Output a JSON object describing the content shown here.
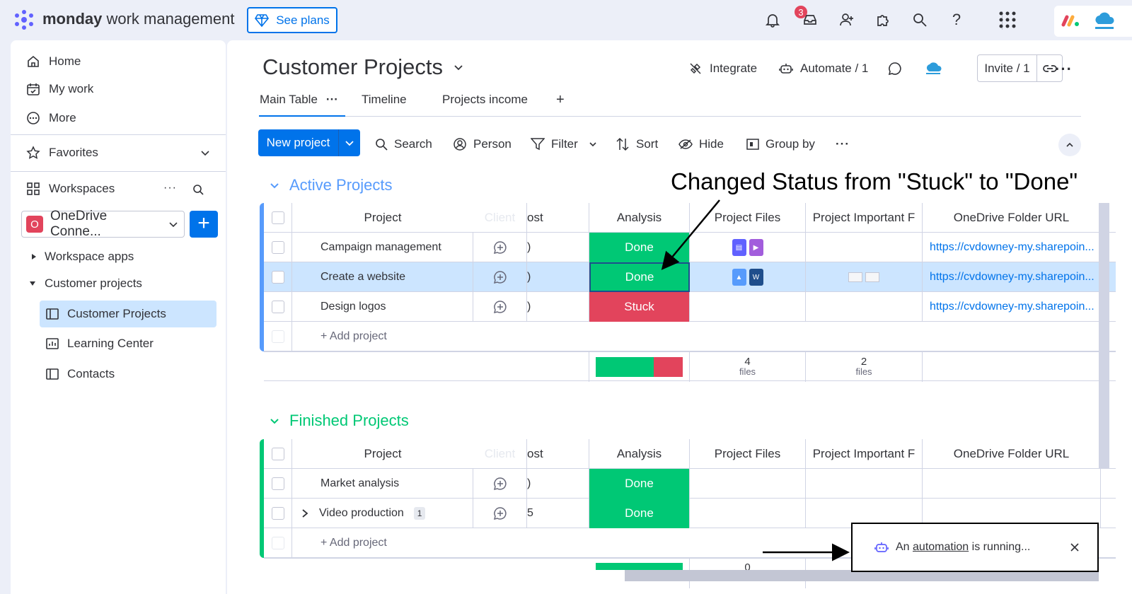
{
  "topbar": {
    "brand_bold": "monday",
    "brand_rest": " work management",
    "see_plans": "See plans",
    "notification_count": "3"
  },
  "sidebar": {
    "nav": [
      {
        "label": "Home",
        "icon": "home-icon"
      },
      {
        "label": "My work",
        "icon": "calendar-check-icon"
      },
      {
        "label": "More",
        "icon": "more-circle-icon"
      }
    ],
    "favorites": "Favorites",
    "workspaces": "Workspaces",
    "workspace_badge": "O",
    "workspace_name": "OneDrive Conne...",
    "tree": [
      {
        "label": "Workspace apps"
      },
      {
        "label": "Customer projects"
      },
      {
        "label": "Customer Projects"
      },
      {
        "label": "Learning Center"
      },
      {
        "label": "Contacts"
      }
    ]
  },
  "board": {
    "title": "Customer Projects",
    "integrate": "Integrate",
    "automate": "Automate / 1",
    "invite": "Invite / 1",
    "tabs": [
      "Main Table",
      "Timeline",
      "Projects income",
      "+"
    ],
    "new_project": "New project",
    "toolbar": [
      "Search",
      "Person",
      "Filter",
      "Sort",
      "Hide",
      "Group by"
    ]
  },
  "annotation": "Changed Status from \"Stuck\" to \"Done\"",
  "groups": [
    {
      "title": "Active Projects",
      "color": "#579bfc",
      "columns": {
        "project": "Project",
        "ghost": "Client",
        "cost": "ost",
        "analysis": "Analysis",
        "files": "Project Files",
        "important": "Project Important F",
        "url": "OneDrive Folder URL"
      },
      "rows": [
        {
          "name": "Campaign management",
          "status": "Done",
          "url": "https://cvdowney-my.sharepoin..."
        },
        {
          "name": "Create a website",
          "status": "Done",
          "url": "https://cvdowney-my.sharepoin..."
        },
        {
          "name": "Design logos",
          "status": "Stuck",
          "url": "https://cvdowney-my.sharepoin..."
        }
      ],
      "add": "+ Add project",
      "summary": {
        "files_count": "4",
        "files_label": "files",
        "important_count": "2",
        "important_label": "files"
      }
    },
    {
      "title": "Finished Projects",
      "color": "#00c875",
      "columns": {
        "project": "Project",
        "ghost": "Client",
        "cost": "ost",
        "analysis": "Analysis",
        "files": "Project Files",
        "important": "Project Important F",
        "url": "OneDrive Folder URL"
      },
      "rows": [
        {
          "name": "Market analysis",
          "status": "Done"
        },
        {
          "name": "Video production",
          "status": "Done",
          "subitems": "1"
        }
      ],
      "add": "+ Add project",
      "summary": {
        "files_count": "0"
      }
    }
  ],
  "toast": {
    "before": "An ",
    "link": "automation",
    "after": " is running..."
  },
  "colors": {
    "accent": "#0073ea",
    "done": "#00c875",
    "stuck": "#e2445c"
  }
}
